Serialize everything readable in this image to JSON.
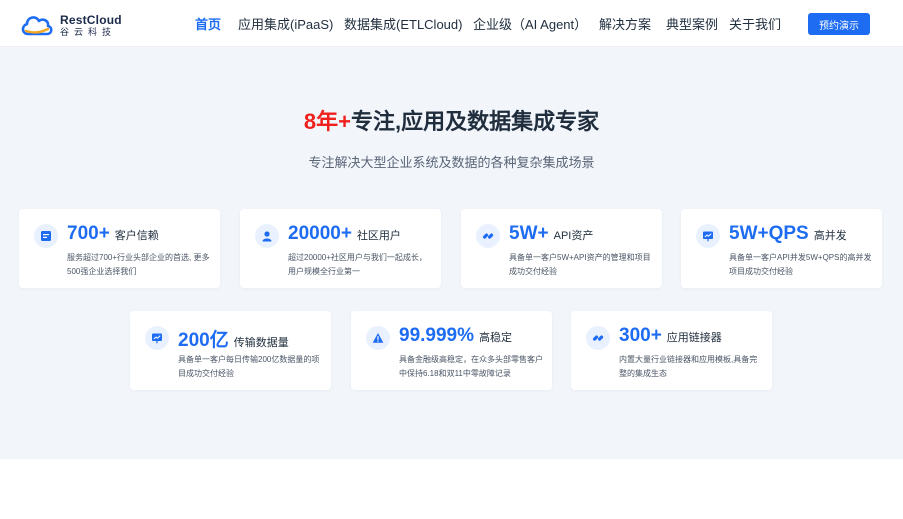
{
  "header": {
    "logo_en": "RestCloud",
    "logo_cn": "谷云科技",
    "nav": [
      {
        "label": "首页",
        "active": true
      },
      {
        "label": "应用集成(iPaaS)",
        "active": false
      },
      {
        "label": "数据集成(ETLCloud)",
        "active": false
      },
      {
        "label": "企业级（AI Agent）",
        "active": false
      },
      {
        "label": "解决方案",
        "active": false
      },
      {
        "label": "典型案例",
        "active": false
      },
      {
        "label": "关于我们",
        "active": false
      }
    ],
    "demo_button": "预约演示"
  },
  "hero": {
    "title_accent": "8年+",
    "title_rest": "专注,应用及数据集成专家",
    "subtitle": "专注解决大型企业系统及数据的各种复杂集成场景"
  },
  "cards": [
    {
      "icon": "card-list-icon",
      "number": "700+",
      "label": "客户信赖",
      "desc": "服务超过700+行业头部企业的首选, 更多500强企业选择我们"
    },
    {
      "icon": "user-icon",
      "number": "20000+",
      "label": "社区用户",
      "desc": "超过20000+社区用户与我们一起成长，用户规模全行业第一"
    },
    {
      "icon": "link-icon",
      "number": "5W+",
      "label": "API资产",
      "desc": "具备单一客户5W+API资产的管理和项目成功交付经验"
    },
    {
      "icon": "chart-board-icon",
      "number": "5W+QPS",
      "label": "高并发",
      "desc": "具备单一客户API并发5W+QPS的高并发项目成功交付经验"
    },
    {
      "icon": "chart-board-icon",
      "number": "200亿",
      "label": "传输数据量",
      "desc": "具备单一客户每日传输200亿数据量的项目成功交付经验"
    },
    {
      "icon": "warning-icon",
      "number": "99.999%",
      "label": "高稳定",
      "desc": "具备金融级高稳定，在众多头部零售客户中保持6.18和双11中零故障记录"
    },
    {
      "icon": "link-icon",
      "number": "300+",
      "label": "应用链接器",
      "desc": "内置大量行业链接器和应用模板,具备完整的集成生态"
    }
  ],
  "colors": {
    "accent": "#1d6cf2",
    "highlight": "#f0201c",
    "background": "#f2f5fa"
  }
}
